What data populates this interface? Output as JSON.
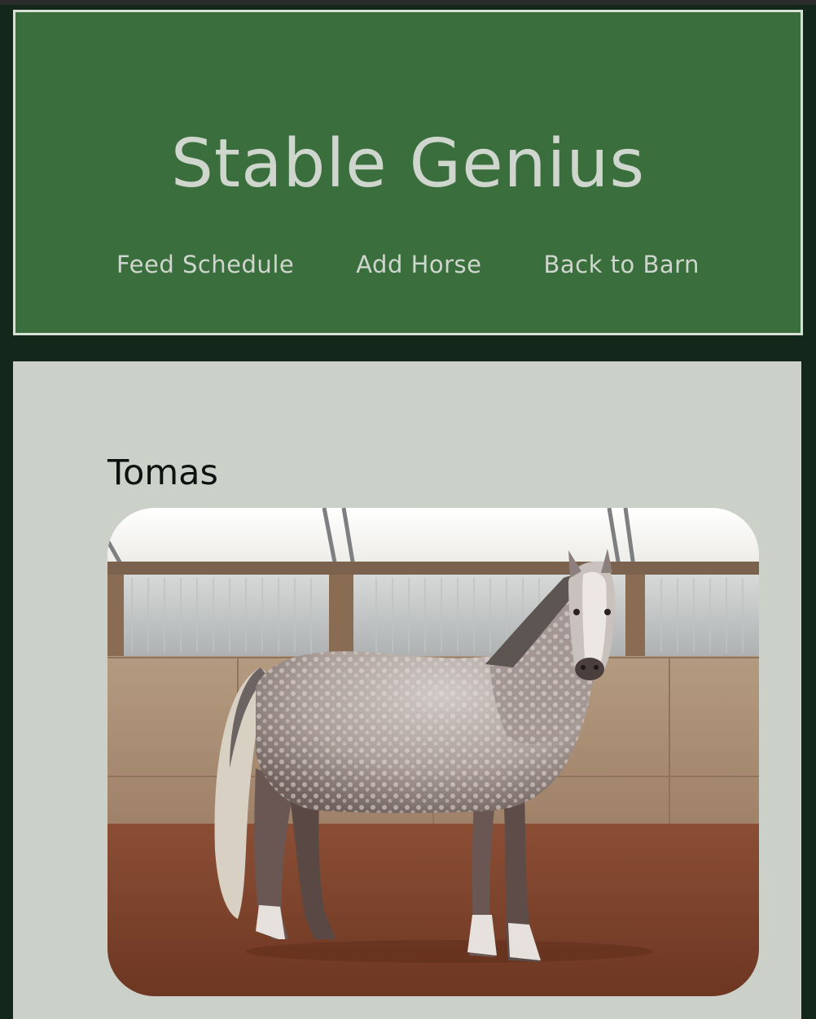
{
  "site": {
    "title": "Stable Genius"
  },
  "nav": {
    "items": [
      {
        "label": "Feed Schedule"
      },
      {
        "label": "Add Horse"
      },
      {
        "label": "Back to Barn"
      }
    ]
  },
  "horse": {
    "name": "Tomas",
    "photo_alt": "dapple gray horse standing in an indoor arena"
  },
  "colors": {
    "page_bg": "#13271a",
    "header_bg": "#3a6e3c",
    "header_text": "#cfd6cd",
    "content_bg": "#cbd1c8"
  }
}
